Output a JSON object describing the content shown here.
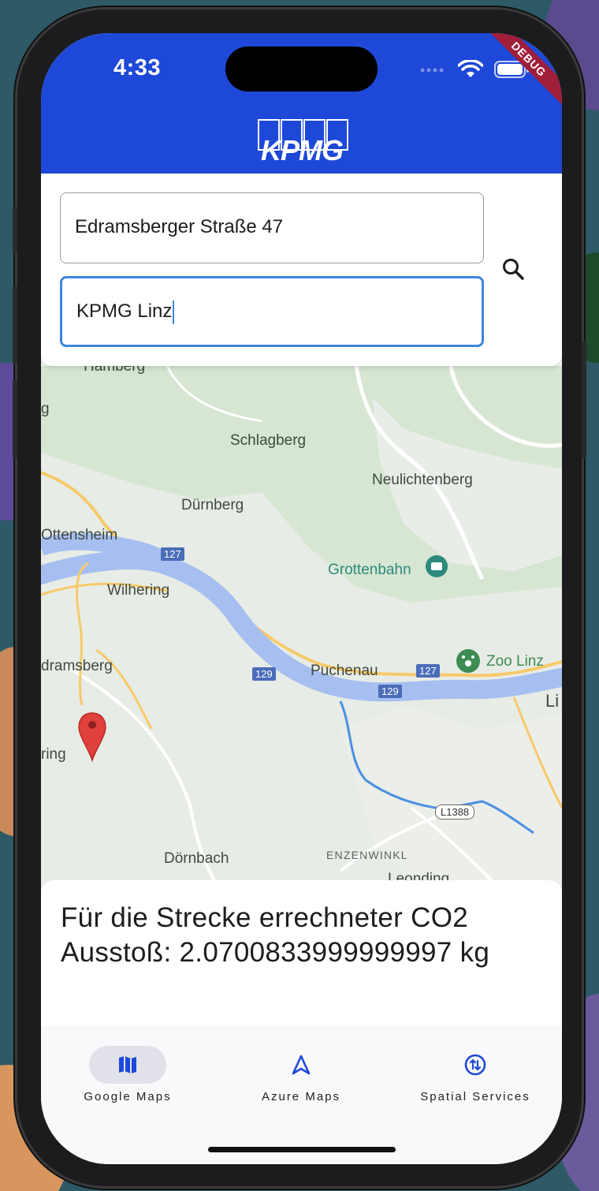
{
  "status_bar": {
    "time": "4:33",
    "debug_label": "DEBUG"
  },
  "app_bar": {
    "logo_text": "KPMG",
    "brand_color": "#1e48d8"
  },
  "search": {
    "from_value": "Edramsberger Straße 47",
    "to_value": "KPMG Linz",
    "search_icon": "search-icon"
  },
  "map": {
    "labels": {
      "hamberg": "Hamberg",
      "g_edge": "g",
      "schlagberg": "Schlagberg",
      "neulichtenberg": "Neulichtenberg",
      "duernberg": "Dürnberg",
      "ottensheim": "Ottensheim",
      "road_127_west": "127",
      "grottenbahn": "Grottenbahn",
      "wilhering": "Wilhering",
      "edramsberg": "dramsberg",
      "zoo_linz": "Zoo Linz",
      "road_129_west": "129",
      "puchenau": "Puchenau",
      "road_127_east": "127",
      "road_129_east": "129",
      "li_edge": "Li",
      "ring_edge": "ring",
      "road_l1388": "L1388",
      "doernbach": "Dörnbach",
      "enzenwinkl": "ENZENWINKL",
      "leonding": "Leonding"
    },
    "colors": {
      "land": "#d6e6d2",
      "river": "#a6bff0",
      "route": "#4a90e2",
      "marker": "#e0413c"
    }
  },
  "co2": {
    "text": "Für die Strecke errechneter CO2 Ausstoß: 2.0700833999999997 kg"
  },
  "bottom_nav": {
    "items": [
      {
        "label": "Google Maps",
        "icon": "map-icon",
        "active": true
      },
      {
        "label": "Azure Maps",
        "icon": "navigation-arrow-icon",
        "active": false
      },
      {
        "label": "Spatial Services",
        "icon": "swap-vertical-icon",
        "active": false
      }
    ],
    "accent_color": "#1e48d8"
  }
}
